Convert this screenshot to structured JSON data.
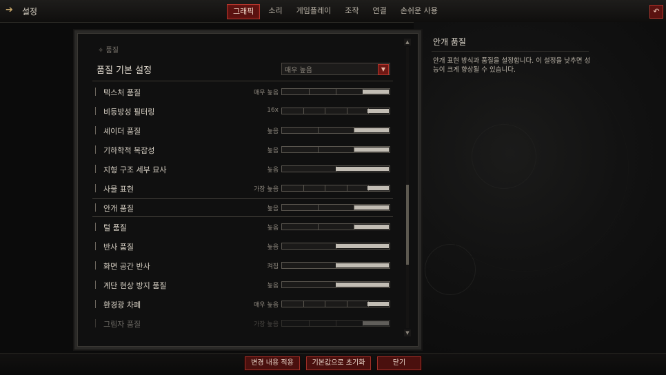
{
  "header": {
    "back_icon": "arrow-left-icon",
    "title": "설정",
    "tabs": [
      {
        "label": "그래픽",
        "active": true
      },
      {
        "label": "소리",
        "active": false
      },
      {
        "label": "게임플레이",
        "active": false
      },
      {
        "label": "조작",
        "active": false
      },
      {
        "label": "연결",
        "active": false
      },
      {
        "label": "손쉬운 사용",
        "active": false
      }
    ],
    "undo_icon": "undo-icon"
  },
  "panel": {
    "breadcrumb": "✧ 품질",
    "section_title": "품질 기본 설정",
    "preset_value": "매우 높음",
    "rows": [
      {
        "label": "텍스처 품질",
        "value": "매우 높음",
        "level": 0.25,
        "segments": 4
      },
      {
        "label": "비등방성 필터링",
        "value": "16x",
        "level": 0.2,
        "segments": 5
      },
      {
        "label": "셰이더 품질",
        "value": "높음",
        "level": 0.33,
        "segments": 3
      },
      {
        "label": "기하학적 복잡성",
        "value": "높음",
        "level": 0.33,
        "segments": 3
      },
      {
        "label": "지형 구조 세부 묘사",
        "value": "높음",
        "level": 0.5,
        "segments": 2
      },
      {
        "label": "사물 표현",
        "value": "가장 높음",
        "level": 0.2,
        "segments": 5
      },
      {
        "label": "안개 품질",
        "value": "높음",
        "level": 0.33,
        "segments": 3,
        "selected": true
      },
      {
        "label": "털 품질",
        "value": "높음",
        "level": 0.33,
        "segments": 3
      },
      {
        "label": "반사 품질",
        "value": "높음",
        "level": 0.5,
        "segments": 2
      },
      {
        "label": "화면 공간 반사",
        "value": "켜짐",
        "level": 0.5,
        "segments": 2
      },
      {
        "label": "계단 현상 방지 품질",
        "value": "높음",
        "level": 0.5,
        "segments": 2
      },
      {
        "label": "환경광 차폐",
        "value": "매우 높음",
        "level": 0.2,
        "segments": 5
      },
      {
        "label": "그림자 품질",
        "value": "가장 높음",
        "level": 0.25,
        "segments": 4,
        "faded": true
      }
    ]
  },
  "info": {
    "title": "안개 품질",
    "description": "안개 표현 방식과 품질을 설정합니다. 이 설정을 낮추면 성능이 크게 향상될 수 있습니다."
  },
  "footer": {
    "apply_label": "변경 내용 적용",
    "reset_label": "기본값으로 초기화",
    "close_label": "닫기"
  },
  "colors": {
    "accent_red": "#b3362d",
    "button_bg": "#4a100e",
    "background": "#0b0b0b"
  }
}
